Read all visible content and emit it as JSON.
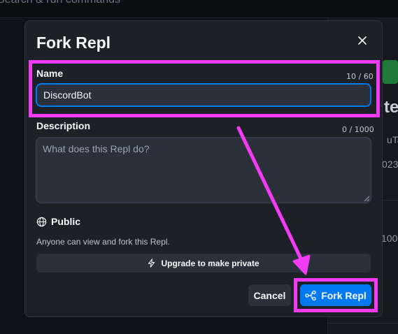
{
  "background": {
    "search_text": "Search & run commands",
    "side_big": "te",
    "side_text_1": "uTa",
    "side_text_2": "023",
    "side_text_3": "100"
  },
  "modal": {
    "title": "Fork Repl",
    "close_icon": "close-icon",
    "name": {
      "label": "Name",
      "counter": "10 / 60",
      "value": "DiscordBot"
    },
    "description": {
      "label": "Description",
      "counter": "0 / 1000",
      "placeholder": "What does this Repl do?",
      "value": ""
    },
    "visibility": {
      "icon": "globe-icon",
      "label": "Public",
      "description": "Anyone can view and fork this Repl."
    },
    "upgrade": {
      "icon": "lightning-icon",
      "label": "Upgrade to make private"
    },
    "cancel_label": "Cancel",
    "fork": {
      "icon": "fork-icon",
      "label": "Fork Repl"
    }
  },
  "colors": {
    "accent": "#0079f2",
    "annotation": "#f23bf2",
    "modal_bg": "#1c2027",
    "input_bg": "#2b313b"
  }
}
